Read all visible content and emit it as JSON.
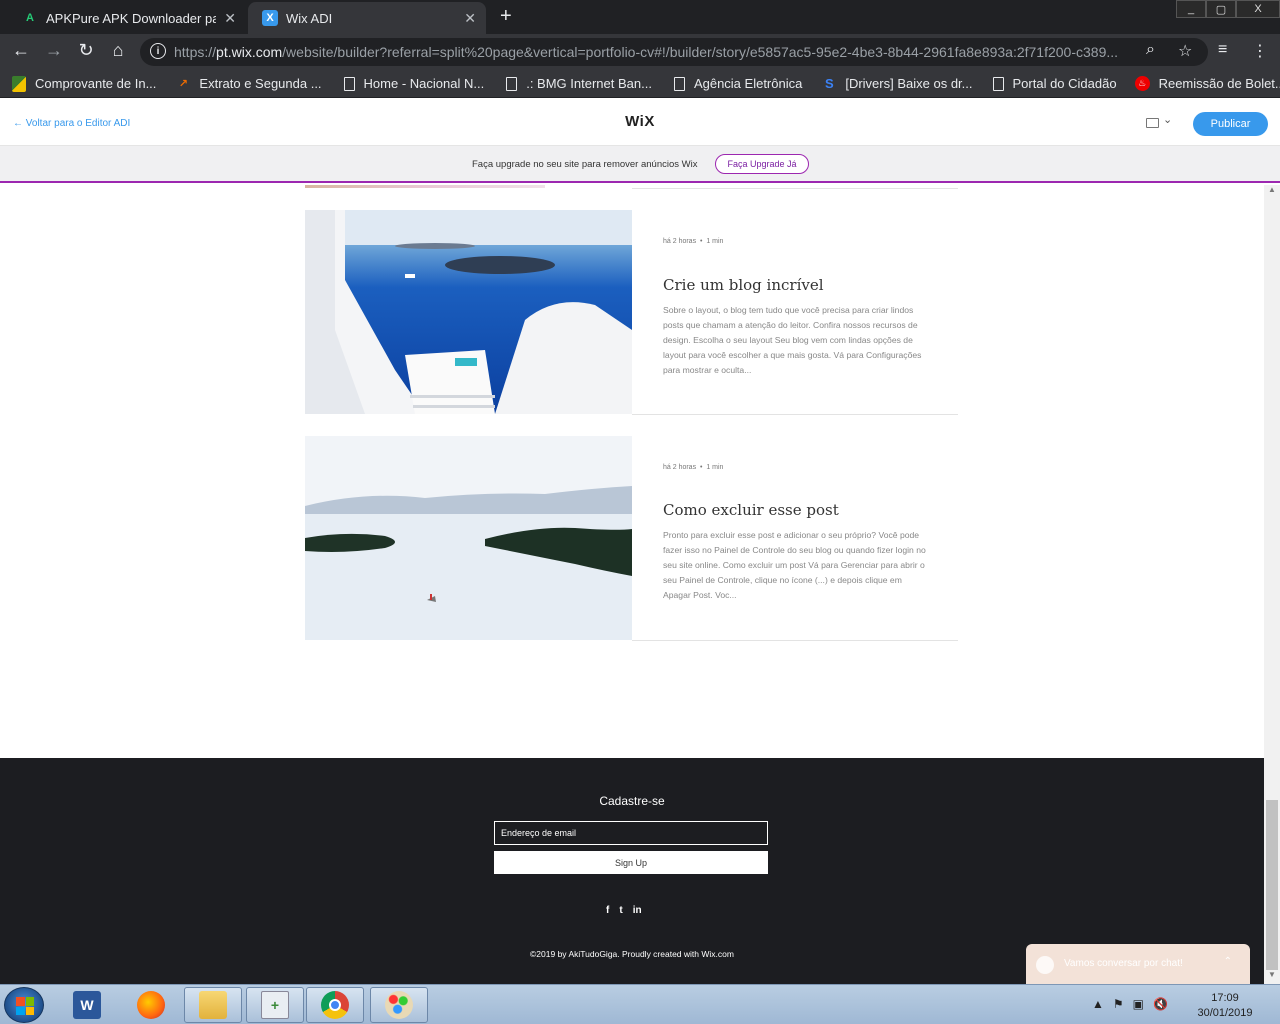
{
  "browser": {
    "tabs": [
      {
        "title": "APKPure APK Downloader para A",
        "favicon": "apkpure-icon",
        "active": false
      },
      {
        "title": "Wix ADI",
        "favicon": "wix-adi-icon",
        "active": true
      }
    ],
    "url_prefix": "https://",
    "url_host": "pt.wix.com",
    "url_rest": "/website/builder?referral=split%20page&vertical=portfolio-cv#!/builder/story/e5857ac5-95e2-4be3-8b44-2961fa8e893a:2f71f200-c389...",
    "window_controls": {
      "minimize": "_",
      "restore": "▢",
      "close": "X"
    },
    "bookmarks": [
      {
        "label": "Comprovante de In...",
        "icon": "flag-icon"
      },
      {
        "label": "Extrato e Segunda ...",
        "icon": "boleto-icon"
      },
      {
        "label": "Home - Nacional N...",
        "icon": "page-icon"
      },
      {
        "label": ".: BMG Internet Ban...",
        "icon": "page-icon"
      },
      {
        "label": "Agência Eletrônica",
        "icon": "page-icon"
      },
      {
        "label": "[Drivers] Baixe os dr...",
        "icon": "s-icon"
      },
      {
        "label": "Portal do Cidadão",
        "icon": "page-icon"
      },
      {
        "label": "Reemissão de Bolet...",
        "icon": "santander-icon"
      }
    ]
  },
  "editor": {
    "back_label": "Voltar para o Editor ADI",
    "logo": "WiX",
    "publish_label": "Publicar",
    "upgrade_message": "Faça upgrade no seu site para remover anúncios Wix",
    "upgrade_button": "Faça Upgrade Já"
  },
  "posts": [
    {
      "meta_time": "há 2 horas",
      "meta_read": "1 min",
      "title": "Crie um blog incrível",
      "excerpt": "Sobre o layout, o blog tem tudo que você precisa para criar lindos posts que chamam a atenção do leitor. Confira nossos recursos de design. Escolha o seu layout Seu blog vem com lindas opções de layout para você escolher a que mais gosta. Vá para Configurações para mostrar e oculta..."
    },
    {
      "meta_time": "há 2 horas",
      "meta_read": "1 min",
      "title": "Como excluir esse post",
      "excerpt": "Pronto para excluir esse post e adicionar o seu próprio? Você pode fazer isso no Painel de Controle do seu blog ou quando fizer login no seu site online. Como excluir um post Vá para Gerenciar para abrir o seu Painel de Controle, clique no ícone (...) e depois clique em Apagar Post. Voc..."
    }
  ],
  "footer": {
    "signup_title": "Cadastre-se",
    "email_placeholder": "Endereço de email",
    "signup_button": "Sign Up",
    "social": [
      "f",
      "t",
      "in"
    ],
    "copyright": "©2019 by AkiTudoGiga. Proudly created with Wix.com"
  },
  "chat": {
    "label": "Vamos conversar por chat!"
  },
  "taskbar": {
    "apps": [
      "word-icon",
      "firefox-icon",
      "file-explorer-icon",
      "notepad-plus-icon",
      "chrome-icon",
      "paint-icon"
    ],
    "time": "17:09",
    "date": "30/01/2019"
  },
  "colors": {
    "accent_blue": "#3899ec",
    "upgrade_purple": "#9c27b0",
    "footer_bg": "#1c1d21",
    "chat_bg": "#f3e2d8"
  }
}
